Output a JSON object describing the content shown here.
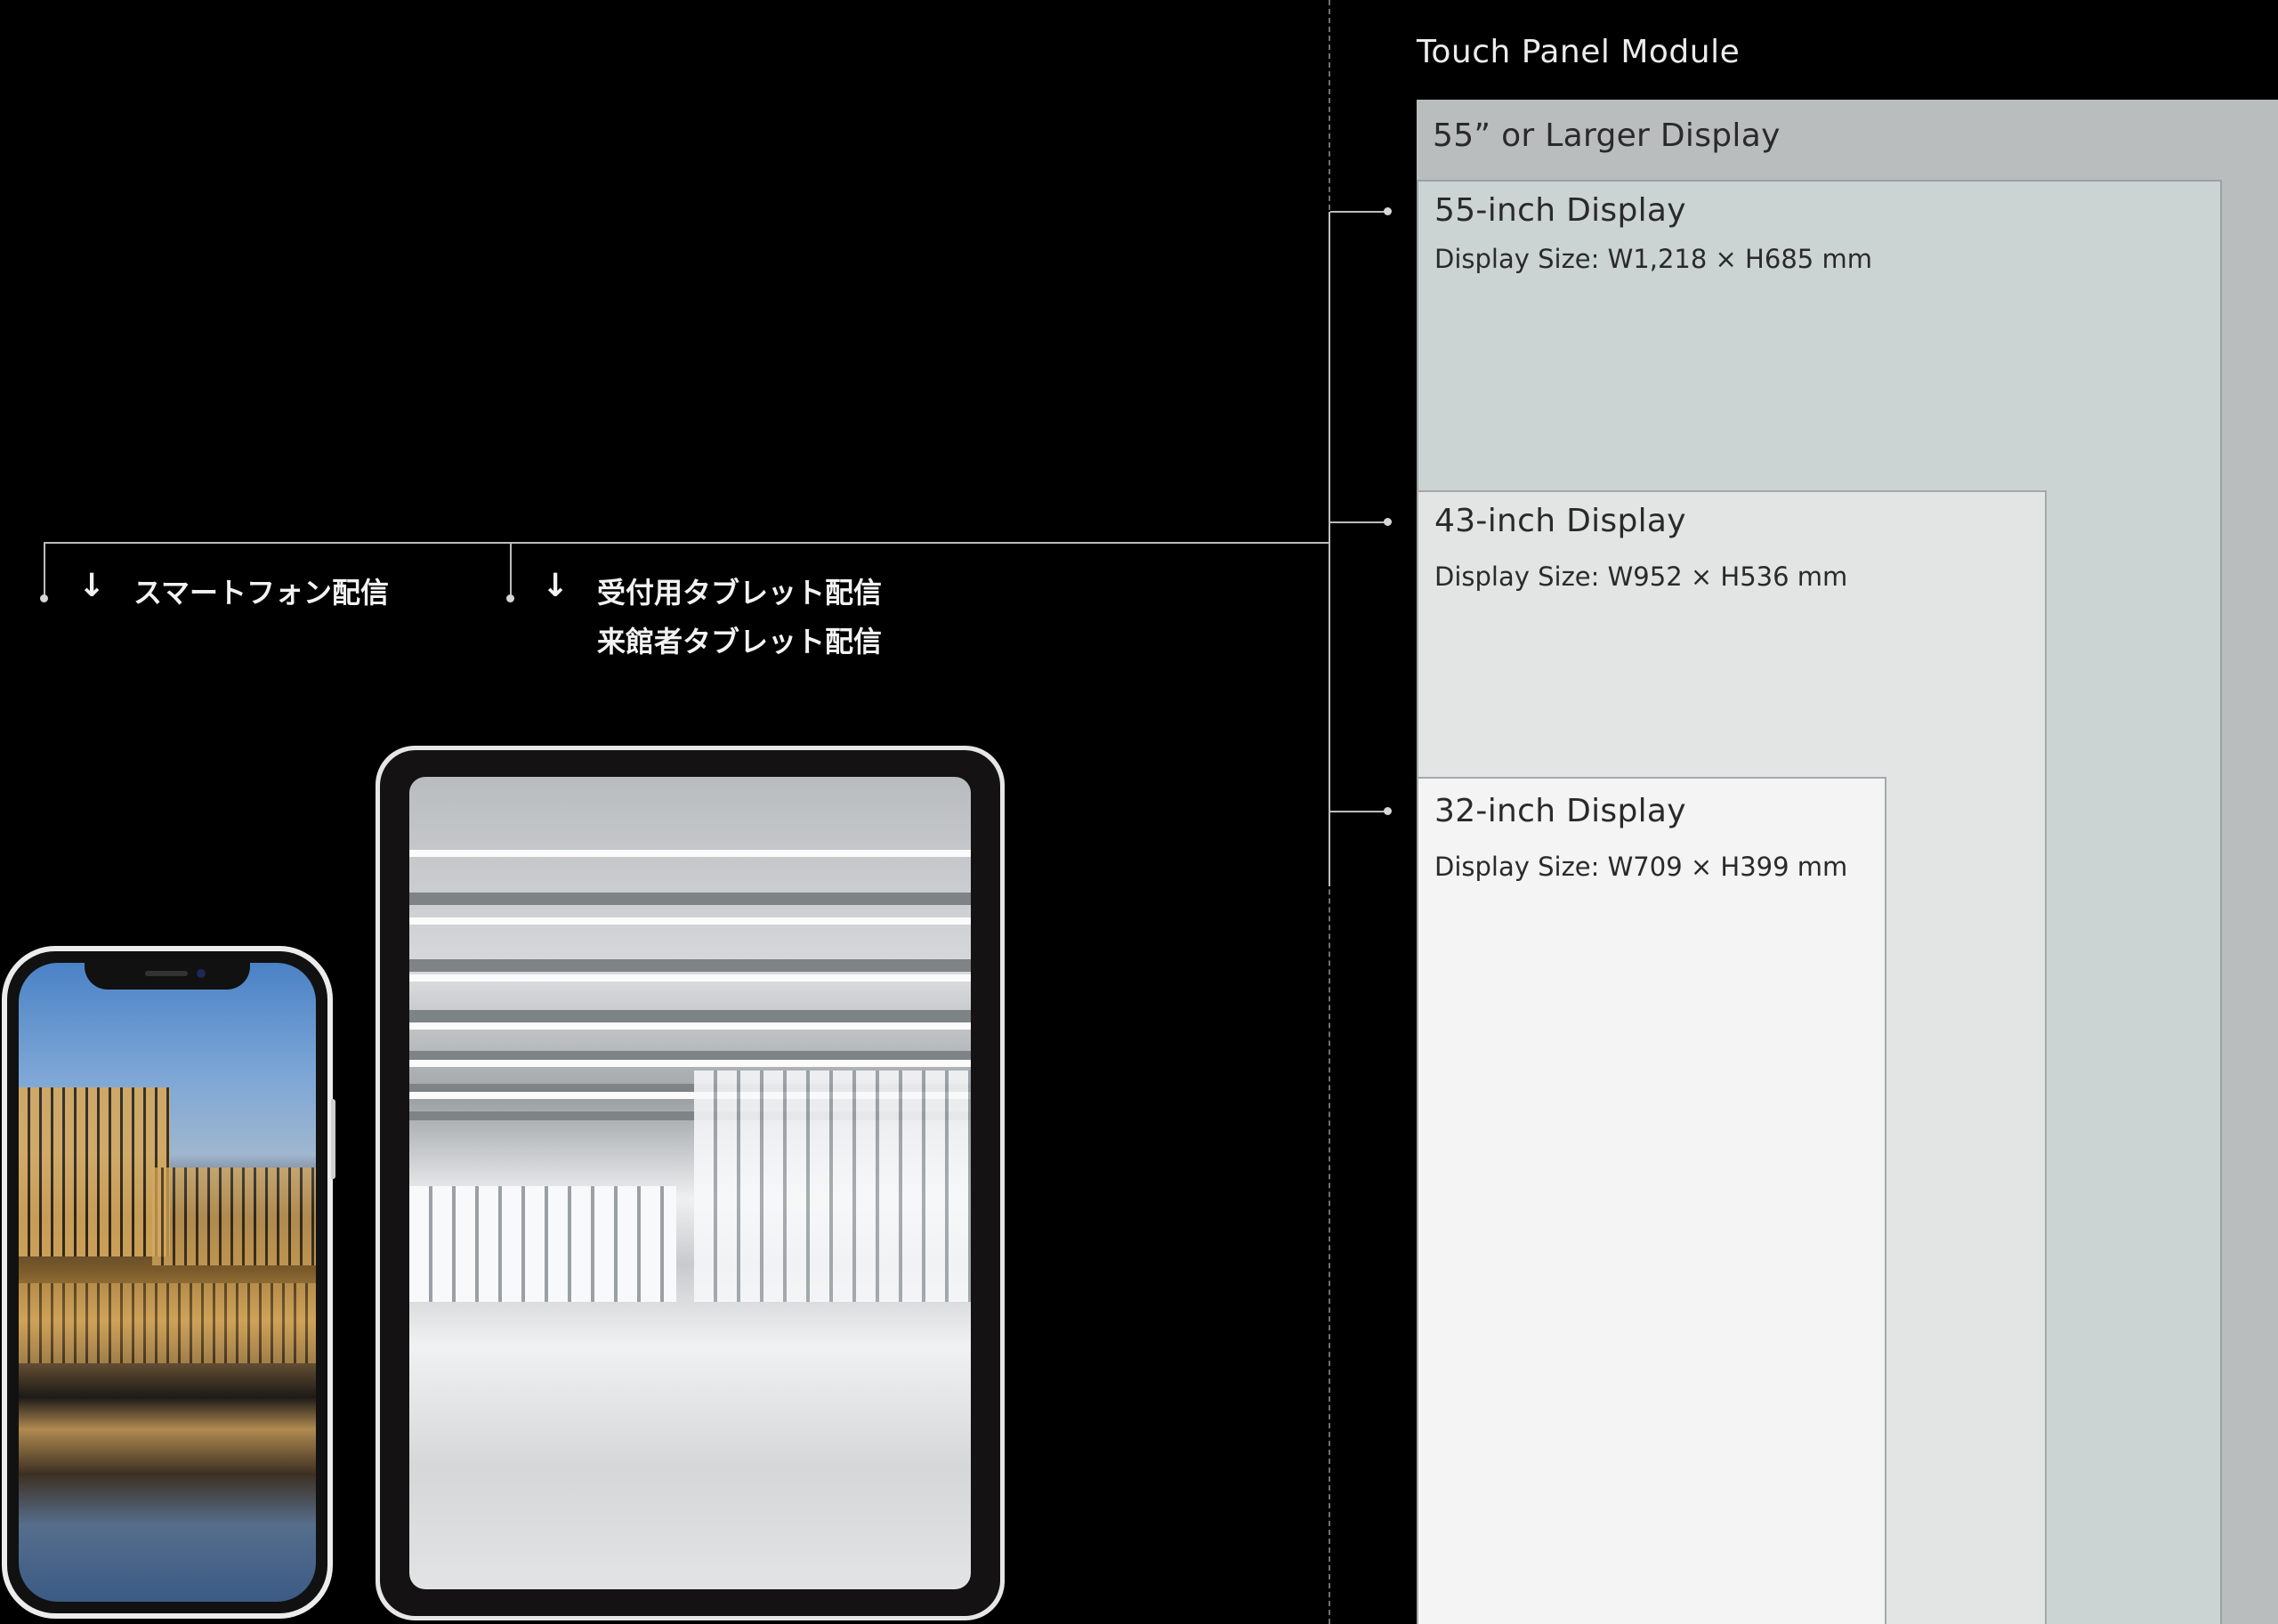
{
  "panel": {
    "title": "Touch Panel Module",
    "large": {
      "label": "55” or Larger Display"
    },
    "d55": {
      "label": "55-inch Display",
      "size": "Display Size: W1,218 × H685 mm"
    },
    "d43": {
      "label": "43-inch Display",
      "size": "Display Size: W952 × H536 mm"
    },
    "d32": {
      "label": "32-inch Display",
      "size": "Display Size: W709 × H399 mm"
    }
  },
  "delivery": {
    "smartphone": "スマートフォン配信",
    "tablet_reception": "受付用タブレット配信",
    "tablet_visitor": "来館者タブレット配信"
  },
  "arrow_glyph": "↓",
  "colors": {
    "background": "#000000",
    "box_xl": "#b9bdbe",
    "box_55": "#ccd3d3",
    "box_43": "#e3e5e5",
    "box_32": "#f4f4f4"
  }
}
